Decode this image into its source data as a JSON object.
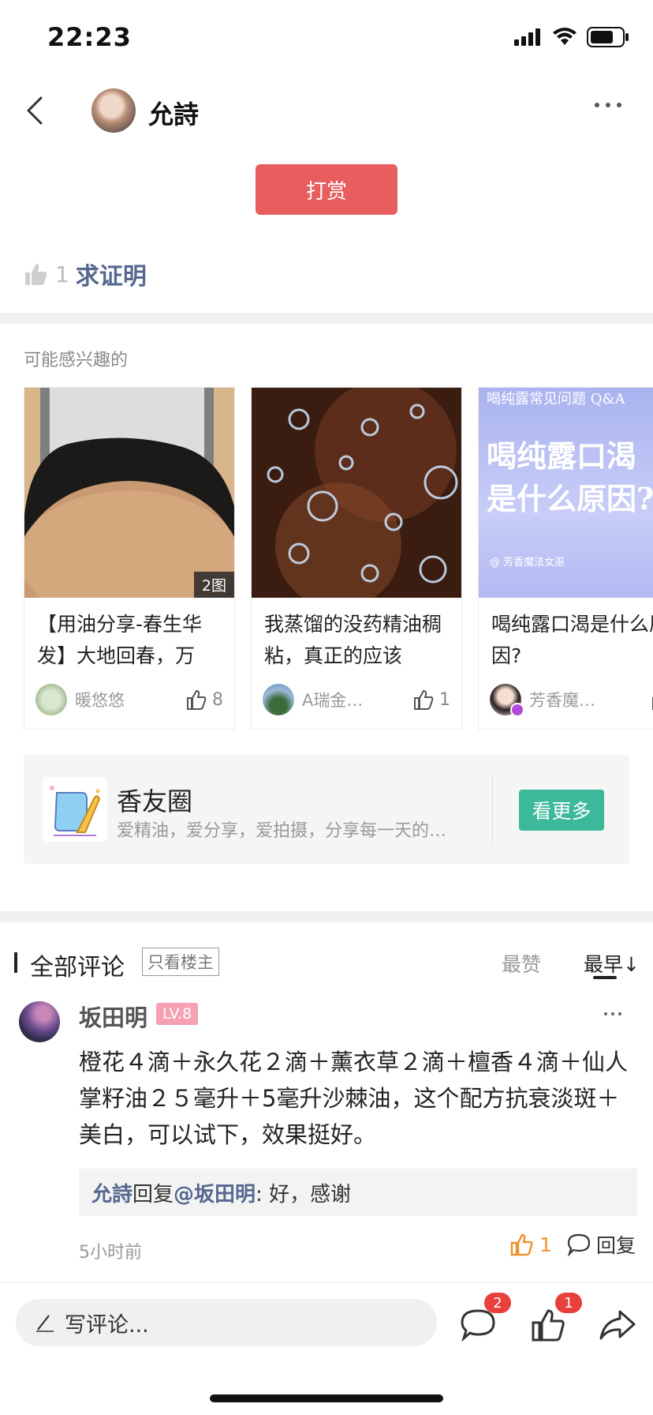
{
  "status": {
    "time": "22:23"
  },
  "header": {
    "author": "允詩"
  },
  "tip": {
    "label": "打赏"
  },
  "post": {
    "like_count": "1",
    "title": "求证明"
  },
  "recommend": {
    "label": "可能感兴趣的",
    "cards": [
      {
        "title": "【用油分享-春生华发】大地回春，万",
        "badge": "2图",
        "user": "暖悠悠",
        "likes": "8"
      },
      {
        "title": "我蒸馏的没药精油稠粘，真正的应该",
        "user": "A瑞金…",
        "likes": "1"
      },
      {
        "title": "喝纯露口渴是什么原因?",
        "user": "芳香魔…",
        "likes": "",
        "thumb_header": "喝纯露常见问题 Q&A",
        "thumb_title": "喝纯露口渴\n是什么原因?",
        "thumb_footer": "@ 芳香魔法女巫"
      }
    ]
  },
  "circle": {
    "name": "香友圈",
    "desc": "爱精油，爱分享，爱拍摄，分享每一天的…",
    "button": "看更多"
  },
  "comments": {
    "title": "全部评论",
    "only_owner": "只看楼主",
    "sort_top": "最赞",
    "sort_early": "最早↓",
    "item": {
      "name": "坂田明",
      "level": "LV.8",
      "text": "橙花４滴＋永久花２滴＋薰衣草２滴＋檀香４滴＋仙人掌籽油２５毫升＋5毫升沙棘油，这个配方抗衰淡斑＋美白，可以试下，效果挺好。",
      "reply_author": "允詩",
      "reply_word": "回复",
      "reply_target": "@坂田明",
      "reply_text": ": 好，感谢",
      "time": "5小时前",
      "likes": "1",
      "reply_btn": "回复"
    }
  },
  "bottom": {
    "placeholder": "写评论...",
    "comment_count": "2",
    "like_count": "1"
  },
  "colors": {
    "tip": "#e85d5d",
    "accent_green": "#3cb89a",
    "link_blue": "#56688f",
    "badge_red": "#e8403c",
    "level_pink": "#f6a0b4",
    "like_orange": "#f09230"
  }
}
